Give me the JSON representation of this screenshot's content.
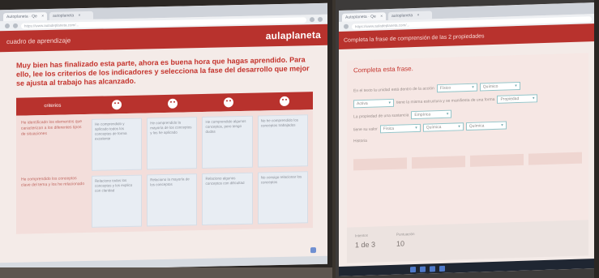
{
  "left_photo": {
    "tabs": [
      {
        "label": "Autoplaneta · Qe",
        "close": "×"
      },
      {
        "label": "autoplaneta",
        "close": "×"
      }
    ],
    "url": "https://www.auladeplaneta.com/...",
    "app_title": "cuadro de aprendizaje",
    "brand": "aulaplaneta",
    "intro": "Muy bien has finalizado esta parte, ahora es buena hora que hagas aprendido. Para ello, lee los criterios de los indicadores y selecciona la fase del desarrollo que mejor se ajusta al trabajo has alcanzado.",
    "column_header_first": "criterios",
    "criteria": [
      "He identificado los elementos que caracterizan a los diferentes tipos de situaciones",
      "He comprendido los conceptos clave del tema y los he relacionado"
    ],
    "cells_row1": [
      "He comprendido y aplicado todos los conceptos de forma excelente",
      "He comprendido la mayoría de los conceptos y los he aplicado",
      "He comprendido algunos conceptos, pero tengo dudas",
      "No he comprendido los conceptos trabajados"
    ],
    "cells_row2": [
      "Relaciono todos los conceptos y los explico con claridad",
      "Relaciono la mayoría de los conceptos",
      "Relaciono algunos conceptos con dificultad",
      "No consigo relacionar los conceptos"
    ]
  },
  "right_photo": {
    "tabs": [
      {
        "label": "Autoplaneta · Qe",
        "close": "×"
      },
      {
        "label": "autoplaneta",
        "close": "×"
      }
    ],
    "url": "https://www.auladeplaneta.com/...",
    "app_title": "Completa la frase de comprensión de las 2 propiedades",
    "section_title": "Completa esta frase.",
    "sentences": [
      {
        "text": "En el texto la unidad está dentro de la acción",
        "selects": [
          "Físico",
          "Químico"
        ]
      },
      {
        "text": "tiene la misma estructura y se manifiesta de una forma",
        "selects": [
          "Activa",
          "Propiedad"
        ]
      },
      {
        "text": "La propiedad de una sustancia",
        "selects": [
          "Empírica"
        ]
      },
      {
        "text": "tiene su valor",
        "selects": [
          "Física",
          "Química",
          "Química"
        ]
      }
    ],
    "extra_text": "Historia",
    "footer": [
      {
        "label": "Intentos",
        "value": "1 de 3"
      },
      {
        "label": "Puntuación",
        "value": "10"
      }
    ]
  }
}
